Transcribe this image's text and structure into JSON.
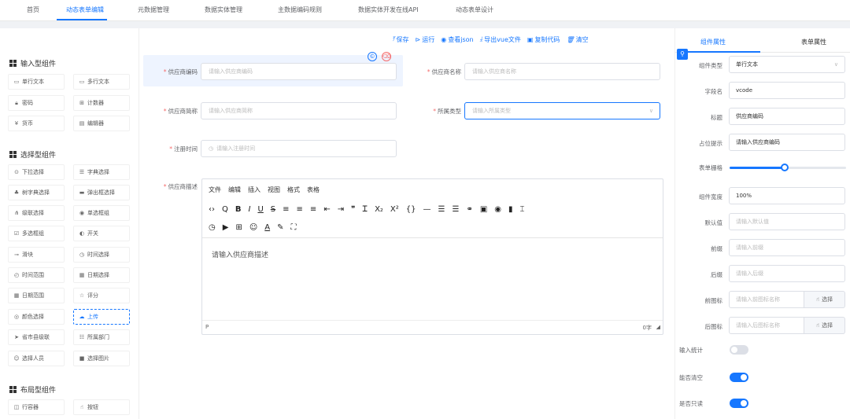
{
  "nav": {
    "tabs": [
      "首页",
      "动态表单编辑",
      "元数据管理",
      "数据实体管理",
      "主数据编码规则",
      "数据实体开发在线API",
      "动态表单设计"
    ],
    "active_index": 1
  },
  "palette": {
    "groups": [
      {
        "title": "输入型组件",
        "items": [
          {
            "icon": "text-icon",
            "label": "单行文本"
          },
          {
            "icon": "textarea-icon",
            "label": "多行文本"
          },
          {
            "icon": "lock-icon",
            "label": "密码"
          },
          {
            "icon": "counter-icon",
            "label": "计数器"
          },
          {
            "icon": "currency-icon",
            "label": "货币"
          },
          {
            "icon": "editor-icon",
            "label": "编辑器"
          }
        ]
      },
      {
        "title": "选择型组件",
        "items": [
          {
            "icon": "select-icon",
            "label": "下拉选择"
          },
          {
            "icon": "dict-icon",
            "label": "字典选择"
          },
          {
            "icon": "tree-icon",
            "label": "树字典选择"
          },
          {
            "icon": "popup-icon",
            "label": "弹出框选择"
          },
          {
            "icon": "cascade-icon",
            "label": "级联选择"
          },
          {
            "icon": "radio-icon",
            "label": "单选框组"
          },
          {
            "icon": "checkbox-icon",
            "label": "多选框组"
          },
          {
            "icon": "switch-icon",
            "label": "开关"
          },
          {
            "icon": "slider-icon",
            "label": "滑块"
          },
          {
            "icon": "clock-icon",
            "label": "时间选择"
          },
          {
            "icon": "time-range-icon",
            "label": "时间范围"
          },
          {
            "icon": "calendar-icon",
            "label": "日期选择"
          },
          {
            "icon": "date-range-icon",
            "label": "日期范围"
          },
          {
            "icon": "star-icon",
            "label": "评分"
          },
          {
            "icon": "color-icon",
            "label": "颜色选择"
          },
          {
            "icon": "upload-icon",
            "label": "上传"
          },
          {
            "icon": "location-icon",
            "label": "省市县级联"
          },
          {
            "icon": "dept-icon",
            "label": "所属部门"
          },
          {
            "icon": "user-icon",
            "label": "选择人员"
          },
          {
            "icon": "image-icon",
            "label": "选择图片"
          }
        ]
      },
      {
        "title": "布局型组件",
        "items": [
          {
            "icon": "container-icon",
            "label": "行容器"
          },
          {
            "icon": "button-icon",
            "label": "按钮"
          }
        ]
      }
    ]
  },
  "toolbar": {
    "items": [
      {
        "icon": "save-icon",
        "label": "保存"
      },
      {
        "icon": "run-icon",
        "label": "运行"
      },
      {
        "icon": "view-icon",
        "label": "查看json"
      },
      {
        "icon": "export-icon",
        "label": "导出vue文件"
      },
      {
        "icon": "copy-icon",
        "label": "复制代码"
      },
      {
        "icon": "trash-icon",
        "label": "清空"
      }
    ]
  },
  "form": {
    "f1": {
      "label": "供应商编码",
      "placeholder": "请输入供应商编码"
    },
    "f2": {
      "label": "供应商名称",
      "placeholder": "请输入供应商名称"
    },
    "f3": {
      "label": "供应商简称",
      "placeholder": "请输入供应商简称"
    },
    "f4": {
      "label": "所属类型",
      "placeholder": "请输入所属类型"
    },
    "f5": {
      "label": "注册时间",
      "placeholder": "请输入注册时间"
    },
    "f6": {
      "label": "供应商描述"
    },
    "editor": {
      "menu": [
        "文件",
        "编辑",
        "插入",
        "视图",
        "格式",
        "表格"
      ],
      "placeholder": "请输入供应商描述",
      "footer_left": "P",
      "footer_right": "0字"
    }
  },
  "props": {
    "tabs": [
      "组件属性",
      "表单属性"
    ],
    "component_type": {
      "label": "组件类型",
      "value": "单行文本"
    },
    "field_name": {
      "label": "字段名",
      "value": "vcode"
    },
    "title": {
      "label": "标题",
      "value": "供应商编码"
    },
    "placeholder": {
      "label": "占位提示",
      "value": "请输入供应商编码"
    },
    "grid": {
      "label": "表单栅格",
      "value": 0.47
    },
    "width": {
      "label": "组件宽度",
      "value": "100%"
    },
    "default": {
      "label": "默认值",
      "placeholder": "请输入默认值"
    },
    "prefix": {
      "label": "前缀",
      "placeholder": "请输入前缀"
    },
    "suffix": {
      "label": "后缀",
      "placeholder": "请输入后缀"
    },
    "prefix_icon": {
      "label": "前图标",
      "placeholder": "请输入前图标名称",
      "button": "选择"
    },
    "suffix_icon": {
      "label": "后图标",
      "placeholder": "请输入后图标名称",
      "button": "选择"
    },
    "show_count": {
      "label": "输入统计",
      "on": false
    },
    "clearable": {
      "label": "能否清空",
      "on": true
    },
    "readonly": {
      "label": "是否只读",
      "on": true
    }
  },
  "colors": {
    "accent": "#1677ff",
    "danger": "#f56c6c",
    "active_bg": "#eef4ff"
  }
}
